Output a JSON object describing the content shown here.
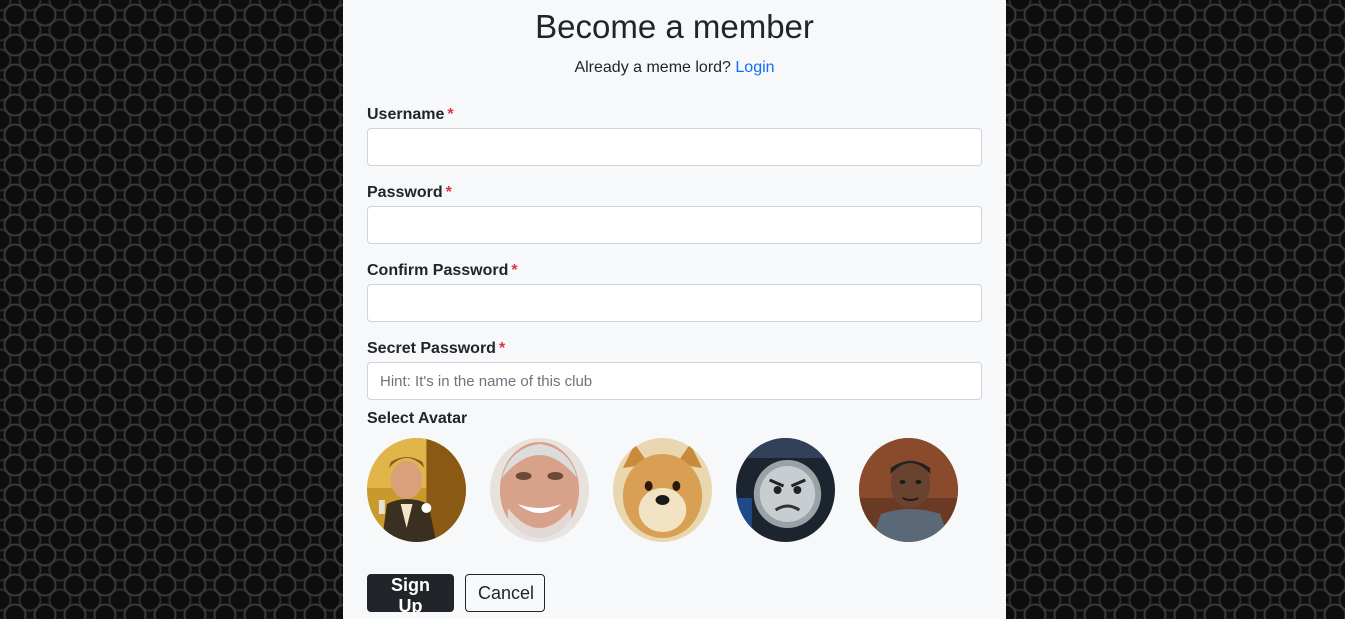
{
  "header": {
    "title": "Become a member",
    "login_prompt": "Already a meme lord?",
    "login_link": "Login"
  },
  "form": {
    "username": {
      "label": "Username",
      "required_mark": "*",
      "value": "",
      "placeholder": ""
    },
    "password": {
      "label": "Password",
      "required_mark": "*",
      "value": "",
      "placeholder": ""
    },
    "confirm_password": {
      "label": "Confirm Password",
      "required_mark": "*",
      "value": "",
      "placeholder": ""
    },
    "secret_password": {
      "label": "Secret Password",
      "required_mark": "*",
      "value": "",
      "placeholder": "Hint: It's in the name of this club"
    },
    "avatar": {
      "label": "Select Avatar",
      "options": [
        "laughing-leo-avatar",
        "hide-the-pain-harold-avatar",
        "doge-avatar",
        "angry-thomas-avatar",
        "will-smith-avatar"
      ]
    }
  },
  "actions": {
    "submit_label": "Sign Up",
    "cancel_label": "Cancel"
  },
  "colors": {
    "link": "#0d6efd",
    "required": "#dc3545",
    "primary_button": "#212529",
    "panel_background": "#f7f8fa"
  }
}
